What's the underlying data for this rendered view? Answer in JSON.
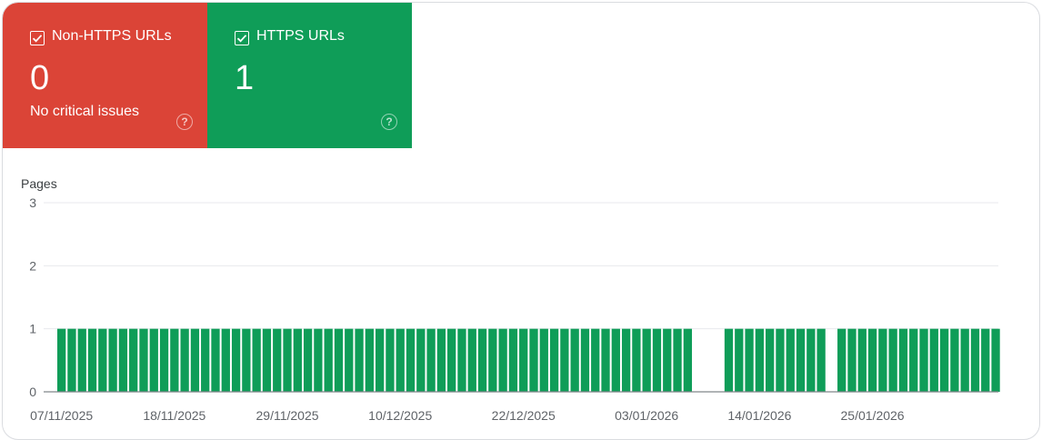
{
  "tiles": [
    {
      "label": "Non-HTTPS URLs",
      "value": "0",
      "subtitle": "No critical issues",
      "checked": true,
      "color": "#db4437",
      "help_icon": "help-circle-icon"
    },
    {
      "label": "HTTPS URLs",
      "value": "1",
      "subtitle": "",
      "checked": true,
      "color": "#0f9d58",
      "help_icon": "help-circle-icon"
    }
  ],
  "chart_data": {
    "type": "bar",
    "ylabel": "Pages",
    "ylim": [
      0,
      3
    ],
    "yticks": [
      "0",
      "1",
      "2",
      "3"
    ],
    "grid": true,
    "bar_color": "#0f9d58",
    "xtick_labels": [
      "07/11/2025",
      "18/11/2025",
      "29/11/2025",
      "10/12/2025",
      "22/12/2025",
      "03/01/2026",
      "14/01/2026",
      "25/01/2026"
    ],
    "xtick_index": [
      0,
      11,
      22,
      33,
      45,
      57,
      68,
      79
    ],
    "values": [
      1,
      1,
      1,
      1,
      1,
      1,
      1,
      1,
      1,
      1,
      1,
      1,
      1,
      1,
      1,
      1,
      1,
      1,
      1,
      1,
      1,
      1,
      1,
      1,
      1,
      1,
      1,
      1,
      1,
      1,
      1,
      1,
      1,
      1,
      1,
      1,
      1,
      1,
      1,
      1,
      1,
      1,
      1,
      1,
      1,
      1,
      1,
      1,
      1,
      1,
      1,
      1,
      1,
      1,
      1,
      1,
      1,
      1,
      1,
      1,
      1,
      1,
      0,
      0,
      0,
      1,
      1,
      1,
      1,
      1,
      1,
      1,
      1,
      1,
      1,
      0,
      1,
      1,
      1,
      1,
      1,
      1,
      1,
      1,
      1,
      1,
      1,
      1,
      1,
      1,
      1,
      1
    ]
  }
}
